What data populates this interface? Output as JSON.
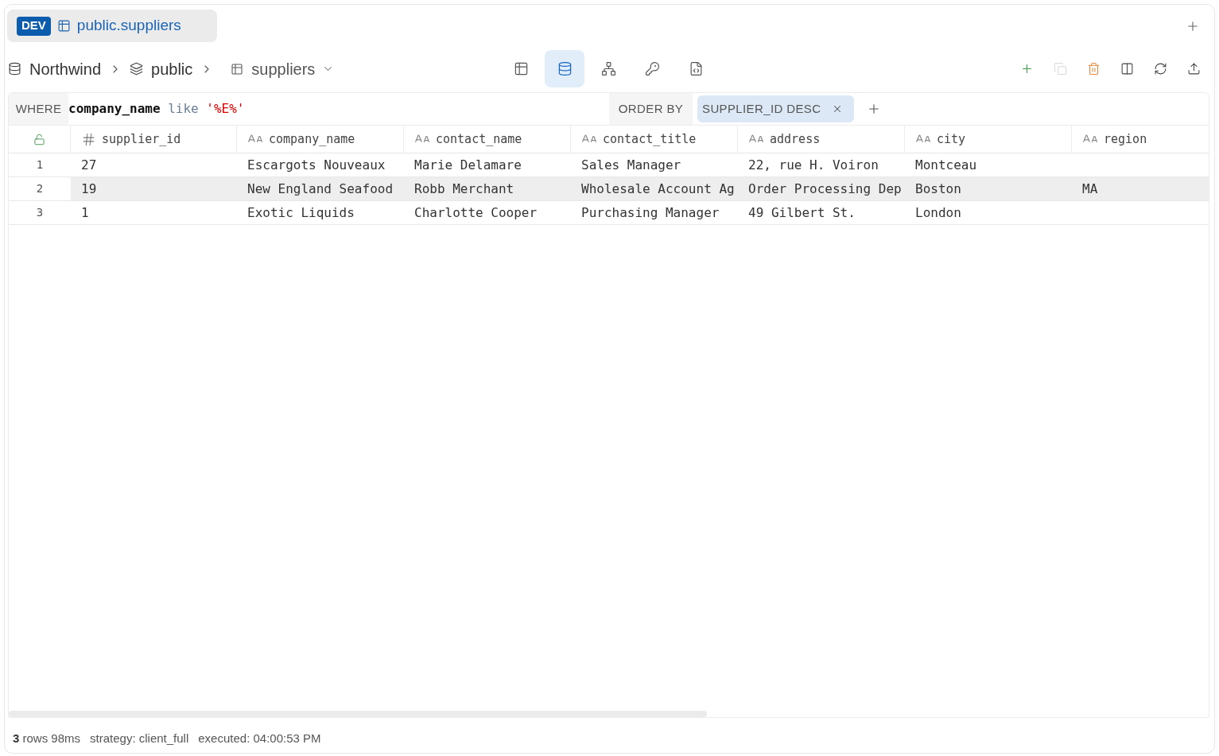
{
  "tabs": [
    {
      "badge": "DEV",
      "title": "public.suppliers",
      "selected": true
    }
  ],
  "breadcrumb": [
    {
      "kind": "database",
      "label": "Northwind",
      "dropdown": false
    },
    {
      "kind": "schema",
      "label": "public",
      "dropdown": false
    },
    {
      "kind": "table",
      "label": "suppliers",
      "dropdown": true
    }
  ],
  "views": [
    {
      "selected": false
    },
    {
      "selected": true
    },
    {
      "selected": false
    },
    {
      "selected": false
    },
    {
      "selected": false
    }
  ],
  "actions": [
    {
      "disabled": false
    },
    {
      "disabled": true
    },
    {
      "disabled": false
    },
    {
      "disabled": false
    },
    {
      "disabled": false
    },
    {
      "disabled": false
    }
  ],
  "filter": {
    "where_label": "WHERE",
    "where_tokens": [
      {
        "kind": "identifier",
        "text": "company_name"
      },
      {
        "kind": "keyword",
        "text": "like"
      },
      {
        "kind": "string",
        "text": "'%E%'"
      }
    ],
    "order_label": "ORDER BY",
    "order_chips": [
      {
        "label": "SUPPLIER_ID DESC"
      }
    ]
  },
  "table": {
    "columns": [
      {
        "kind": "number",
        "name": "supplier_id"
      },
      {
        "kind": "text",
        "name": "company_name"
      },
      {
        "kind": "text",
        "name": "contact_name"
      },
      {
        "kind": "text",
        "name": "contact_title"
      },
      {
        "kind": "text",
        "name": "address"
      },
      {
        "kind": "text",
        "name": "city"
      },
      {
        "kind": "text",
        "name": "region"
      }
    ],
    "rows": [
      {
        "number": "1",
        "selected": false,
        "cells": [
          "27",
          "Escargots Nouveaux",
          "Marie Delamare",
          "Sales Manager",
          "22, rue H. Voiron",
          "Montceau"
        ]
      },
      {
        "number": "2",
        "selected": true,
        "cells": [
          "19",
          "New England Seafood",
          "Robb Merchant",
          "Wholesale Account Ag",
          "Order Processing Dep",
          "Boston",
          "MA"
        ]
      },
      {
        "number": "3",
        "selected": false,
        "cells": [
          "1",
          "Exotic Liquids",
          "Charlotte Cooper",
          "Purchasing Manager",
          "49 Gilbert St.",
          "London"
        ]
      }
    ]
  },
  "status_bar": {
    "summary": "**3** rows 98ms",
    "strategy": "strategy: client_full",
    "executed": "executed: 04:00:53 PM"
  }
}
